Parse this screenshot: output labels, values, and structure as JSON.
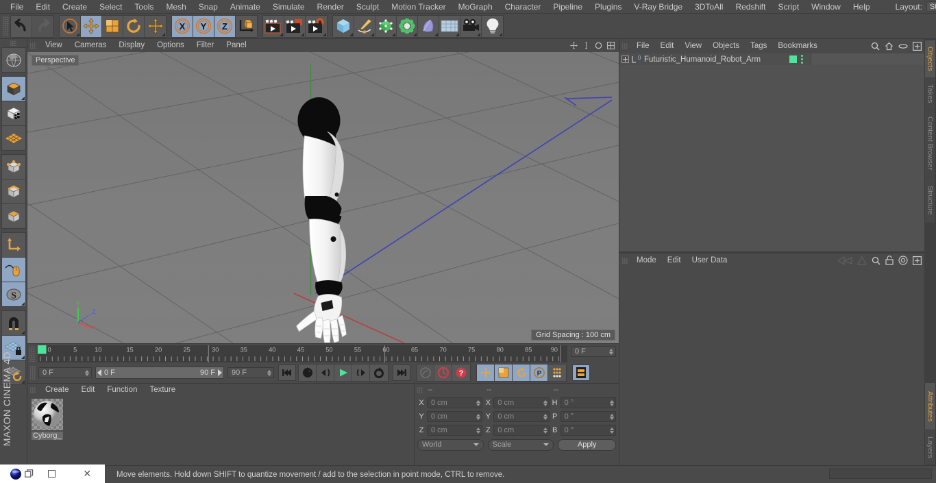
{
  "app": {
    "name": "CINEMA 4D",
    "brand_line1": "MAXON",
    "brand_line2": "CINEMA 4D"
  },
  "menubar": {
    "items": [
      "File",
      "Edit",
      "Create",
      "Select",
      "Tools",
      "Mesh",
      "Snap",
      "Animate",
      "Simulate",
      "Render",
      "Sculpt",
      "Motion Tracker",
      "MoGraph",
      "Character",
      "Pipeline",
      "Plugins",
      "V-Ray Bridge",
      "3DToAll",
      "Redshift",
      "Script",
      "Window",
      "Help"
    ],
    "layout_label": "Layout:",
    "layout_value": "Startup",
    "search_icon": "search-icon"
  },
  "toolbar": {
    "undo": "undo-icon",
    "redo": "redo-icon",
    "select": "live-selection-icon",
    "move": "move-tool-icon",
    "scale": "scale-tool-icon",
    "rotate": "rotate-tool-icon",
    "move_alt": "move-axis-icon",
    "axis_x": "X",
    "axis_y": "Y",
    "axis_z": "Z",
    "world_axis": "world-coordinate-icon",
    "render_view": "render-view-icon",
    "render_picture": "render-to-picture-viewer-icon",
    "render_settings": "render-settings-icon",
    "cube": "add-cube-object-icon",
    "spline": "add-spline-icon",
    "generator": "add-generator-icon",
    "deformer": "add-deformer-icon",
    "scene": "add-scene-object-icon",
    "environment": "add-environment-icon",
    "camera": "add-camera-icon",
    "light": "add-light-icon"
  },
  "left_toolbar": {
    "items": [
      {
        "name": "make-editable-icon",
        "active": false
      },
      {
        "name": "model-mode-icon",
        "active": true
      },
      {
        "name": "texture-mode-icon",
        "active": false
      },
      {
        "name": "workplane-mode-icon",
        "active": false
      },
      {
        "name": "points-mode-icon",
        "active": false
      },
      {
        "name": "edges-mode-icon",
        "active": false
      },
      {
        "name": "polygons-mode-icon",
        "active": false
      },
      {
        "name": "axis-mode-icon",
        "active": false
      },
      {
        "name": "enable-snapping-icon",
        "active": true
      },
      {
        "name": "soft-selection-icon",
        "active": true
      },
      {
        "name": "magnet-tool-icon",
        "active": false
      },
      {
        "name": "workplane-lock-icon",
        "active": true
      },
      {
        "name": "planar-workplane-icon",
        "active": false
      }
    ]
  },
  "viewport": {
    "menu": [
      "View",
      "Cameras",
      "Display",
      "Options",
      "Filter",
      "Panel"
    ],
    "label": "Perspective",
    "grid_spacing": "Grid Spacing : 100 cm",
    "axis_gizmo": {
      "x": "X",
      "y": "Y",
      "z": "Z"
    },
    "icons": [
      "viewport-move-icon",
      "viewport-scale-icon",
      "viewport-rotate-icon",
      "viewport-maximize-icon"
    ],
    "bg_color": "#6f6f6f",
    "floor_color": "#8a8a8a",
    "grid_color": "#5a5a5a",
    "x_axis_color": "#c44040",
    "z_axis_color": "#4040c4",
    "y_axis_color": "#3ea83e",
    "model_name": "Futuristic Humanoid Robot Arm"
  },
  "timeline": {
    "ticks": [
      "0",
      "5",
      "10",
      "15",
      "20",
      "25",
      "30",
      "35",
      "40",
      "45",
      "50",
      "55",
      "60",
      "65",
      "70",
      "75",
      "80",
      "85",
      "90"
    ],
    "current_frame_field": "0 F",
    "start_field": "0 F",
    "range_start": "0 F",
    "range_end": "90 F",
    "end_field": "90 F",
    "playhead_color": "#4ee49a",
    "buttons": [
      {
        "name": "go-to-start-button",
        "glyph": "⏮"
      },
      {
        "name": "previous-keyframe-button",
        "glyph": "↺"
      },
      {
        "name": "previous-frame-button",
        "glyph": "◀|"
      },
      {
        "name": "play-button",
        "glyph": "▶"
      },
      {
        "name": "next-frame-button",
        "glyph": "|▶"
      },
      {
        "name": "next-keyframe-button",
        "glyph": "↻"
      },
      {
        "name": "go-to-end-button",
        "glyph": "⏭"
      },
      {
        "name": "record-active-objects-button",
        "glyph": "◉"
      },
      {
        "name": "autokeying-button",
        "glyph": "◎"
      },
      {
        "name": "keyframe-selection-button",
        "glyph": "?"
      }
    ],
    "key_toggles": [
      "key-position-icon",
      "key-scale-icon",
      "key-rotation-icon",
      "key-parameter-icon",
      "key-pla-icon"
    ],
    "timeline_mode_icon": "animation-mode-icon"
  },
  "material_manager": {
    "menu": [
      "Create",
      "Edit",
      "Function",
      "Texture"
    ],
    "materials": [
      {
        "name": "Cyborg_",
        "preview": "material-sphere-preview"
      }
    ]
  },
  "coordinates": {
    "headers": [
      "--",
      "--",
      "--"
    ],
    "rows": [
      {
        "label_pos": "X",
        "value_pos": "0 cm",
        "label_size": "X",
        "value_size": "0 cm",
        "label_rot": "H",
        "value_rot": "0 °"
      },
      {
        "label_pos": "Y",
        "value_pos": "0 cm",
        "label_size": "Y",
        "value_size": "0 cm",
        "label_rot": "P",
        "value_rot": "0 °"
      },
      {
        "label_pos": "Z",
        "value_pos": "0 cm",
        "label_size": "Z",
        "value_size": "0 cm",
        "label_rot": "B",
        "value_rot": "0 °"
      }
    ],
    "coord_system": "World",
    "transform_mode": "Scale",
    "apply_label": "Apply"
  },
  "object_manager": {
    "menu": [
      "File",
      "Edit",
      "View",
      "Objects",
      "Tags",
      "Bookmarks"
    ],
    "icons": [
      "search-icon",
      "home-icon",
      "ellipse-icon",
      "expand-icon"
    ],
    "objects": [
      {
        "name": "Futuristic_Humanoid_Robot_Arm",
        "layer_badge": "0",
        "tag_color": "#4ee49a"
      }
    ]
  },
  "attribute_manager": {
    "menu": [
      "Mode",
      "Edit",
      "User Data"
    ],
    "icons": [
      "prev-icon",
      "next-icon",
      "search-icon",
      "lock-icon",
      "target-icon",
      "expand-icon"
    ]
  },
  "right_tabs": {
    "top": [
      "Objects",
      "Takes",
      "Content Browser",
      "Structure"
    ],
    "top_selected": "Objects",
    "bottom": [
      "Attributes",
      "Layers"
    ],
    "bottom_selected": "Attributes"
  },
  "statusbar": {
    "message": "Move elements. Hold down SHIFT to quantize movement / add to the selection in point mode, CTRL to remove."
  },
  "window_overlay": {
    "app_icon": "cinema4d-app-icon",
    "restore": "restore-window-icon",
    "maximize": "maximize-window-icon",
    "close": "close-window-icon",
    "close_glyph": "✕"
  },
  "colors": {
    "accent_orange": "#e0a33c",
    "active_blue": "#8fa7c4",
    "panel_bg": "#4a4a4a",
    "green": "#4ee49a"
  }
}
